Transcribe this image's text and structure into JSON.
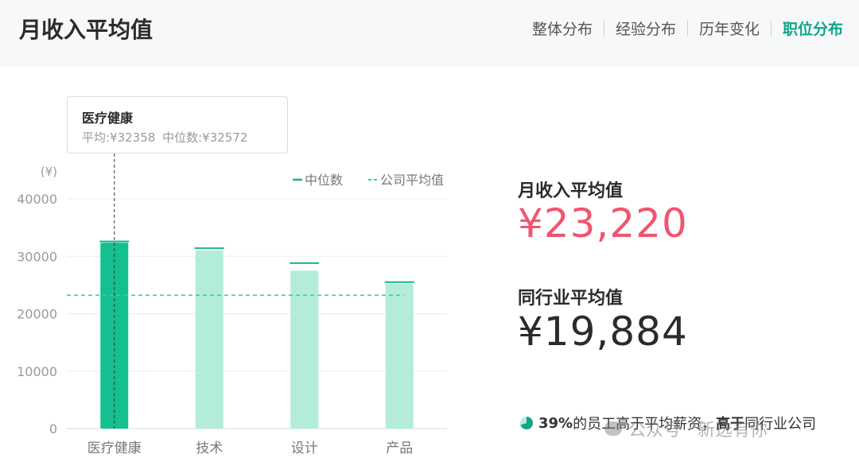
{
  "page": {
    "title": "月收入平均值"
  },
  "tabs": [
    {
      "label": "整体分布",
      "active": false
    },
    {
      "label": "经验分布",
      "active": false
    },
    {
      "label": "历年变化",
      "active": false
    },
    {
      "label": "职位分布",
      "active": true
    }
  ],
  "tooltip": {
    "title": "医疗健康",
    "avg_label": "平均:¥32358",
    "median_label": "中位数:¥32572"
  },
  "stats": {
    "monthly_avg_label": "月收入平均值",
    "monthly_avg_value": "¥23,220",
    "industry_avg_label": "同行业平均值",
    "industry_avg_value": "¥19,884"
  },
  "footnote": {
    "pct": "39%",
    "text1": "的员工高于平均薪资，",
    "text2": "高于",
    "text3": "同行业公司"
  },
  "watermark": {
    "text": "公众号 · 新选有你"
  },
  "colors": {
    "accent": "#0fa68a",
    "bar_active": "#14c08f",
    "bar": "#b3ecdb",
    "median": "#12b886",
    "company_avg": "#2fcf9e",
    "red_value": "#f0566f",
    "dark_value": "#2b2b2b"
  },
  "chart_data": {
    "type": "bar",
    "unit_label": "(¥)",
    "categories": [
      "医疗健康",
      "技术",
      "设计",
      "产品"
    ],
    "series": [
      {
        "name": "平均",
        "values": [
          32358,
          31000,
          27500,
          25200
        ]
      },
      {
        "name": "中位数",
        "values": [
          32572,
          31400,
          28800,
          25500
        ]
      }
    ],
    "company_average": 23220,
    "legend": [
      "中位数",
      "公司平均值"
    ],
    "yticks": [
      0,
      10000,
      20000,
      30000,
      40000
    ],
    "ylim": [
      0,
      40000
    ],
    "highlight_index": 0,
    "grid": true,
    "legend_position": "top-right"
  }
}
